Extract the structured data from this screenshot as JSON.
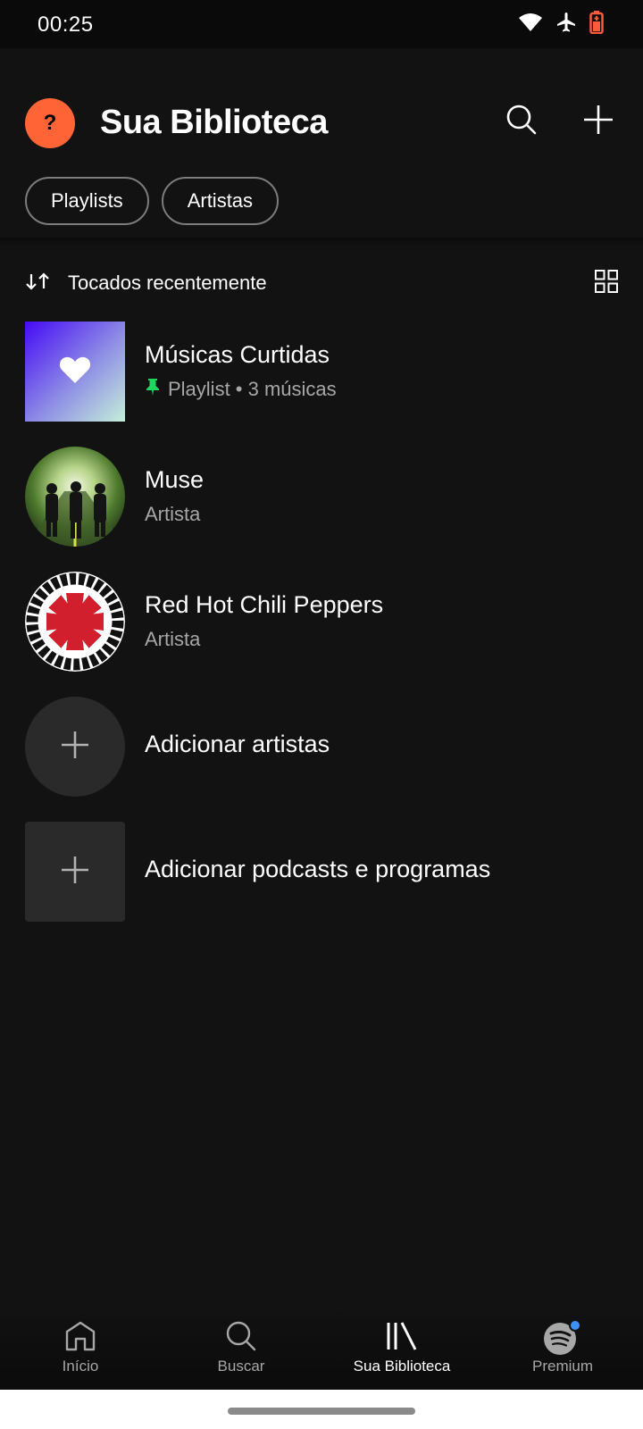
{
  "status_bar": {
    "time": "00:25",
    "icons": [
      "wifi-icon",
      "airplane-icon",
      "battery-icon"
    ],
    "battery_color": "#ff5a3c"
  },
  "header": {
    "avatar_letter": "?",
    "avatar_color": "#ff6437",
    "title": "Sua Biblioteca",
    "search_icon": "search-icon",
    "add_icon": "plus-icon"
  },
  "filters": {
    "chips": [
      {
        "label": "Playlists"
      },
      {
        "label": "Artistas"
      }
    ]
  },
  "sort": {
    "label": "Tocados recentemente",
    "sort_icon": "sort-arrows-icon",
    "view_icon": "grid-view-icon"
  },
  "library": {
    "items": [
      {
        "title": "Músicas Curtidas",
        "subtitle": "Playlist • 3 músicas",
        "pinned": true,
        "pin_color": "#1ed760",
        "kind": "liked-songs"
      },
      {
        "title": "Muse",
        "subtitle": "Artista",
        "kind": "artist"
      },
      {
        "title": "Red Hot Chili Peppers",
        "subtitle": "Artista",
        "kind": "artist",
        "logo_text": "RED HOT CHILI PEPPERS"
      },
      {
        "title": "Adicionar artistas",
        "kind": "add-artists"
      },
      {
        "title": "Adicionar podcasts e programas",
        "kind": "add-podcasts"
      }
    ]
  },
  "bottom_nav": {
    "items": [
      {
        "label": "Início",
        "icon": "home-icon",
        "active": false
      },
      {
        "label": "Buscar",
        "icon": "search-icon",
        "active": false
      },
      {
        "label": "Sua Biblioteca",
        "icon": "library-icon",
        "active": true
      },
      {
        "label": "Premium",
        "icon": "spotify-icon",
        "active": false,
        "badge_color": "#3d91f4"
      }
    ]
  }
}
